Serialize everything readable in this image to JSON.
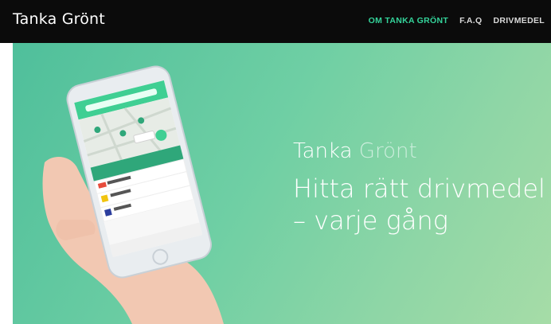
{
  "header": {
    "logo": "Tanka Grönt",
    "nav": [
      {
        "label": "OM TANKA GRÖNT",
        "active": true
      },
      {
        "label": "F.A.Q",
        "active": false
      },
      {
        "label": "DRIVMEDEL",
        "active": false
      }
    ]
  },
  "hero": {
    "brand_part1": "Tanka",
    "brand_part2": "Grönt",
    "headline_line1": "Hitta rätt drivmedel",
    "headline_line2": "– varje gång"
  },
  "colors": {
    "nav_background": "#0b0b0b",
    "accent": "#34d39a",
    "hero_gradient_start": "#4fbf9b",
    "hero_gradient_end": "#a6dca7"
  },
  "icons": [
    "phone-illustration",
    "hand-illustration",
    "map-pin-icon"
  ]
}
